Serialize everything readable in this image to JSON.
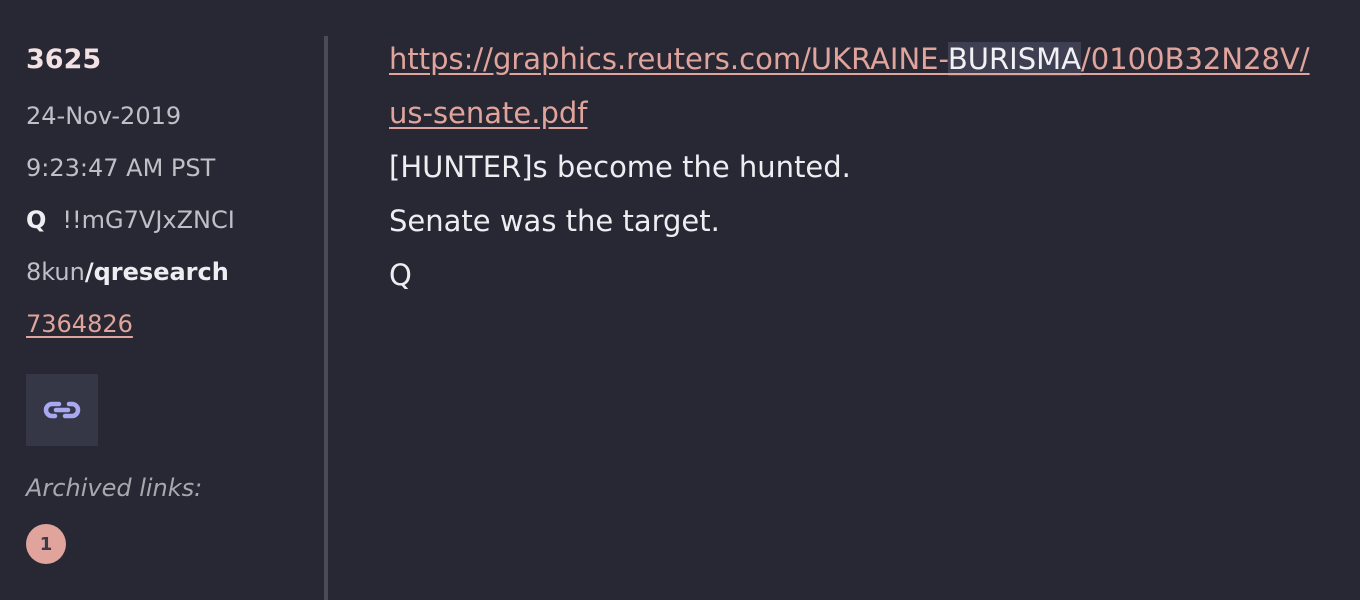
{
  "post": {
    "number": "3625",
    "date": "24-Nov-2019",
    "time": "9:23:47 AM PST",
    "author_name": "Q",
    "tripcode": "!!mG7VJxZNCI",
    "site": "8kun",
    "board": "/qresearch",
    "post_id": "7364826",
    "link_icon": "link-icon",
    "archived_label": "Archived links:",
    "archived_links": [
      "1"
    ]
  },
  "content": {
    "url_line1_before": "https://graphics.reuters.com/UKRAINE-",
    "url_line1_highlight": "BURISMA",
    "url_line1_after": "/0100B32N28V/",
    "url_line2": "us-senate.pdf",
    "lines": [
      "[HUNTER]s become the hunted.",
      "Senate was the target.",
      "Q"
    ]
  },
  "colors": {
    "background": "#272833",
    "link": "#e0a49c",
    "text": "#eeeef2",
    "muted": "#bfc0c7",
    "icon": "#a9a8f2"
  }
}
